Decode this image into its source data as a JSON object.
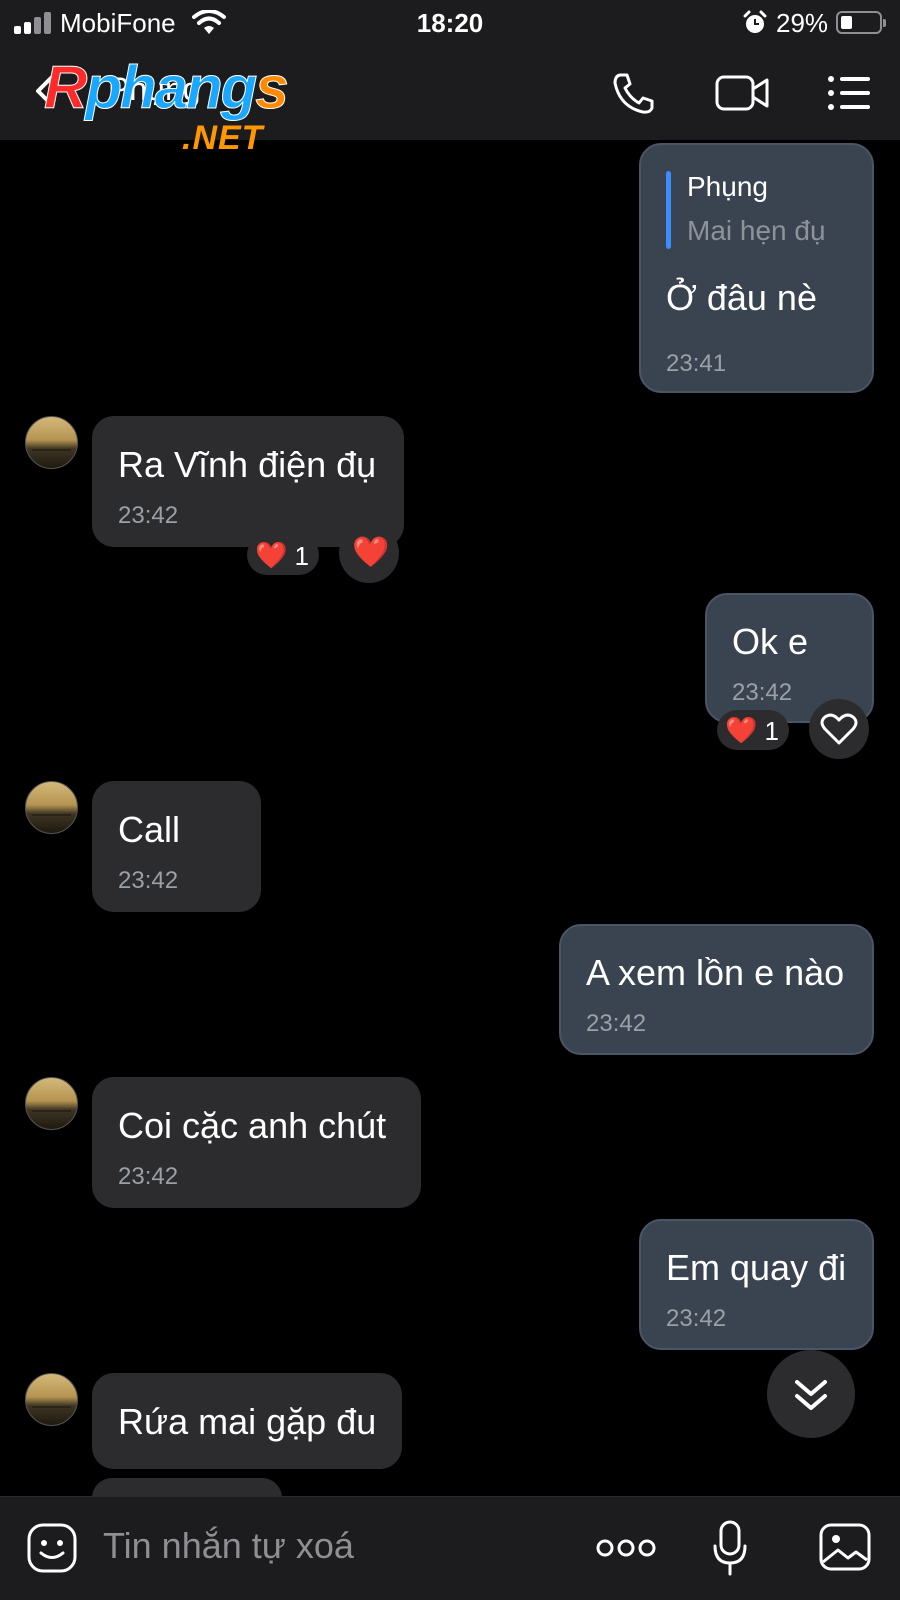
{
  "status": {
    "carrier": "MobiFone",
    "time": "18:20",
    "battery_pct": "29%",
    "battery_level": 0.29
  },
  "header": {
    "contact_name": "Phụng",
    "logo_main_a": "R",
    "logo_main_b": "phang",
    "logo_main_c": "s",
    "logo_sub": ".NET",
    "icons": [
      "back-chevron-icon",
      "phone-icon",
      "video-camera-icon",
      "list-menu-icon"
    ]
  },
  "messages": [
    {
      "side": "out",
      "quote_name": "Phụng",
      "quote_text": "Mai hẹn đụ",
      "text": "Ở đâu nè",
      "time": "23:41"
    },
    {
      "side": "in",
      "text": "Ra Vĩnh điện đụ",
      "time": "23:42",
      "reaction": "❤️",
      "reaction_count": "1",
      "react_button": "❤️"
    },
    {
      "side": "out",
      "text": "Ok e",
      "time": "23:42",
      "reaction": "❤️",
      "reaction_count": "1",
      "react_button": "heart-outline-icon"
    },
    {
      "side": "in",
      "text": "Call",
      "time": "23:42"
    },
    {
      "side": "out",
      "text": "A xem lồn e nào",
      "time": "23:42"
    },
    {
      "side": "in",
      "text": "Coi cặc anh chút",
      "time": "23:42"
    },
    {
      "side": "out",
      "text": "Em quay đi",
      "time": "23:42"
    },
    {
      "side": "in",
      "text": "Rứa mai gặp đu",
      "time": ""
    }
  ],
  "input": {
    "placeholder": "Tin nhắn tự xoá",
    "icons": [
      "sticker-icon",
      "more-icon",
      "microphone-icon",
      "image-icon"
    ]
  },
  "colors": {
    "background": "#000000",
    "bar": "#1c1c1e",
    "incoming_bubble": "#2c2c2e",
    "outgoing_bubble": "#3a4350",
    "quote_accent": "#3d8bfd"
  }
}
